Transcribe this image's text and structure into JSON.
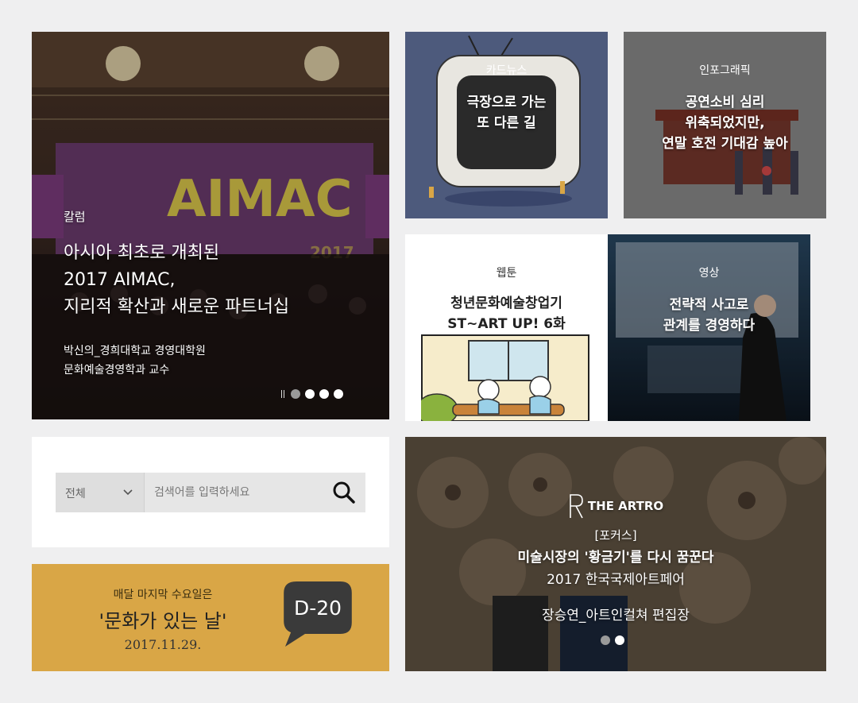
{
  "hero": {
    "category": "칼럼",
    "title_lines": [
      "아시아 최초로 개최된",
      "2017 AIMAC,",
      "지리적 확산과 새로운 파트너십"
    ],
    "author_lines": [
      "박신의_경희대학교 경영대학원",
      "문화예술경영학과 교수"
    ],
    "banner_text": "AIMAC",
    "banner_year": "2017",
    "slides": 4,
    "active_slide": 0
  },
  "card_news": {
    "category": "카드뉴스",
    "title_lines": [
      "극장으로 가는",
      "또 다른 길"
    ]
  },
  "infographic": {
    "category": "인포그래픽",
    "title_lines": [
      "공연소비 심리",
      "위축되었지만,",
      "연말 호전 기대감 높아"
    ]
  },
  "webtoon": {
    "category": "웹툰",
    "title_lines": [
      "청년문화예술창업기",
      "ST~ART UP! 6화"
    ]
  },
  "video": {
    "category": "영상",
    "title_lines": [
      "전략적 사고로",
      "관계를 경영하다"
    ]
  },
  "search": {
    "select_value": "전체",
    "placeholder": "검색어를 입력하세요"
  },
  "culture_day": {
    "pre": "매달 마지막 수요일은",
    "main": "'문화가 있는 날'",
    "date": "2017.11.29.",
    "dday": "D-20"
  },
  "artro": {
    "logo": "THE ARTRO",
    "category": "[포커스]",
    "line1": "미술시장의 '황금기'를 다시 꿈꾼다",
    "line2": "2017 한국국제아트페어",
    "line3": "장승연_아트인컬쳐 편집장",
    "slides": 2,
    "active_slide": 1
  },
  "colors": {
    "page_bg": "#efeff0",
    "card_news_bg": "#4d5a7c",
    "infographic_bg": "#808080",
    "culture_day_bg": "#d9a646",
    "dday_bubble": "#3a3a3a"
  }
}
